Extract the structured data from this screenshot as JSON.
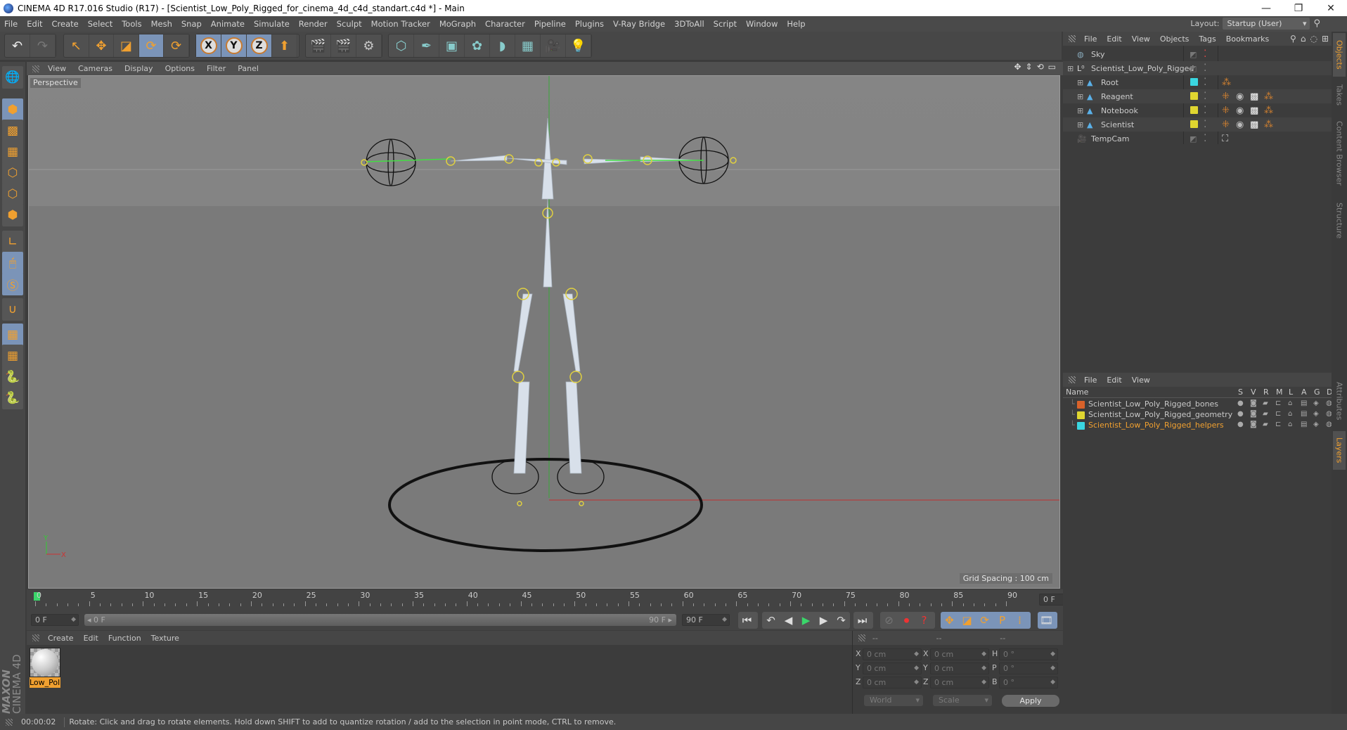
{
  "window": {
    "title": "CINEMA 4D R17.016 Studio (R17) - [Scientist_Low_Poly_Rigged_for_cinema_4d_c4d_standart.c4d *] - Main",
    "controls": {
      "minimize": "—",
      "restore": "❐",
      "close": "✕"
    }
  },
  "menubar": [
    "File",
    "Edit",
    "Create",
    "Select",
    "Tools",
    "Mesh",
    "Snap",
    "Animate",
    "Simulate",
    "Render",
    "Sculpt",
    "Motion Tracker",
    "MoGraph",
    "Character",
    "Pipeline",
    "Plugins",
    "V-Ray Bridge",
    "3DToAll",
    "Script",
    "Window",
    "Help"
  ],
  "layout": {
    "label": "Layout:",
    "value": "Startup (User)"
  },
  "toolbar": {
    "undo": "↶",
    "redo": "↷",
    "tools": [
      {
        "name": "live-selection",
        "glyph": "↖"
      },
      {
        "name": "move",
        "glyph": "✥"
      },
      {
        "name": "scale",
        "glyph": "◪"
      },
      {
        "name": "rotate",
        "glyph": "⟳"
      },
      {
        "name": "recent-tool",
        "glyph": "⟳"
      }
    ],
    "axes": [
      "X",
      "Y",
      "Z"
    ],
    "coord_system": "⬆",
    "render": [
      {
        "name": "render-view",
        "glyph": "🎬"
      },
      {
        "name": "render-picture-viewer",
        "glyph": "🎬"
      },
      {
        "name": "render-settings",
        "glyph": "⚙"
      }
    ],
    "create": [
      {
        "name": "cube",
        "glyph": "⬡"
      },
      {
        "name": "pen",
        "glyph": "✒"
      },
      {
        "name": "subdivision",
        "glyph": "▣"
      },
      {
        "name": "cloner",
        "glyph": "✿"
      },
      {
        "name": "deformer",
        "glyph": "◗"
      },
      {
        "name": "floor",
        "glyph": "▦"
      },
      {
        "name": "camera",
        "glyph": "🎥"
      },
      {
        "name": "light",
        "glyph": "💡"
      }
    ]
  },
  "left_tools": [
    {
      "name": "make-editable",
      "glyph": "🌐",
      "active": false
    },
    {
      "name": "model-mode",
      "glyph": "⬢",
      "active": true
    },
    {
      "name": "texture-mode",
      "glyph": "▩",
      "active": false
    },
    {
      "name": "workplane-mode",
      "glyph": "▦",
      "active": false
    },
    {
      "name": "points-mode",
      "glyph": "⬡",
      "active": false
    },
    {
      "name": "edges-mode",
      "glyph": "⬡",
      "active": false
    },
    {
      "name": "polygons-mode",
      "glyph": "⬢",
      "active": false
    },
    {
      "name": "axis-mode",
      "glyph": "∟",
      "active": false
    },
    {
      "name": "tweak-mode",
      "glyph": "🖱",
      "active": true
    },
    {
      "name": "solo-mode",
      "glyph": "Ⓢ",
      "active": true
    },
    {
      "name": "snap",
      "glyph": "∪",
      "active": false
    },
    {
      "name": "workplane-lock",
      "glyph": "▦",
      "active": true
    },
    {
      "name": "workplane-align",
      "glyph": "▦",
      "active": false
    },
    {
      "name": "python-1",
      "glyph": "🐍",
      "active": false
    },
    {
      "name": "python-2",
      "glyph": "🐍",
      "active": false
    }
  ],
  "viewport": {
    "menu": [
      "View",
      "Cameras",
      "Display",
      "Options",
      "Filter",
      "Panel"
    ],
    "camera_label": "Perspective",
    "grid_spacing": "Grid Spacing : 100 cm",
    "nav_icons": [
      "✥",
      "⇕",
      "⟲",
      "▭"
    ],
    "axis_labels": {
      "x": "X",
      "y": "Y",
      "z": "Z"
    }
  },
  "timeline": {
    "start": 0,
    "end": 90,
    "step": 5,
    "current_frame": 0,
    "current_field": "0 F",
    "range_start": "0 F",
    "range_slider_start": "0 F",
    "range_slider_end": "90 F",
    "range_end": "90 F"
  },
  "playback": {
    "buttons": [
      {
        "name": "go-to-start",
        "glyph": "⏮"
      },
      {
        "name": "prev-key",
        "glyph": "↶"
      },
      {
        "name": "prev-frame",
        "glyph": "◀"
      },
      {
        "name": "play",
        "glyph": "▶"
      },
      {
        "name": "next-frame",
        "glyph": "▶"
      },
      {
        "name": "next-key",
        "glyph": "↷"
      },
      {
        "name": "go-to-end",
        "glyph": "⏭"
      }
    ],
    "record": [
      {
        "name": "keyframe-selection",
        "glyph": "⊘"
      },
      {
        "name": "record-active",
        "glyph": "⏺"
      },
      {
        "name": "autokey",
        "glyph": "?"
      }
    ],
    "key_types": [
      {
        "name": "key-position",
        "glyph": "✥"
      },
      {
        "name": "key-scale",
        "glyph": "◪"
      },
      {
        "name": "key-rotation",
        "glyph": "⟳"
      },
      {
        "name": "key-param",
        "glyph": "P"
      },
      {
        "name": "key-pla",
        "glyph": "⁞"
      }
    ],
    "timeline_button": "🎞"
  },
  "materials": {
    "menu": [
      "Create",
      "Edit",
      "Function",
      "Texture"
    ],
    "items": [
      {
        "label": "Low_Pol"
      }
    ]
  },
  "coordinates": {
    "headers": [
      "--",
      "--",
      "--"
    ],
    "position": [
      {
        "axis": "X",
        "value": "0 cm"
      },
      {
        "axis": "Y",
        "value": "0 cm"
      },
      {
        "axis": "Z",
        "value": "0 cm"
      }
    ],
    "size": [
      {
        "axis": "X",
        "value": "0 cm"
      },
      {
        "axis": "Y",
        "value": "0 cm"
      },
      {
        "axis": "Z",
        "value": "0 cm"
      }
    ],
    "rotation": [
      {
        "axis": "H",
        "value": "0 °"
      },
      {
        "axis": "P",
        "value": "0 °"
      },
      {
        "axis": "B",
        "value": "0 °"
      }
    ],
    "mode": "World",
    "size_mode": "Scale",
    "apply": "Apply"
  },
  "status": {
    "time": "00:00:02",
    "message": "Rotate: Click and drag to rotate elements. Hold down SHIFT to add to quantize rotation / add to the selection in point mode, CTRL to remove."
  },
  "objects_panel": {
    "menu": [
      "File",
      "Edit",
      "View",
      "Objects",
      "Tags",
      "Bookmarks"
    ],
    "objects": [
      {
        "name": "Sky",
        "indent": 0,
        "icon": "sky",
        "color": null,
        "expand": false,
        "tags": []
      },
      {
        "name": "Scientist_Low_Poly_Rigged",
        "indent": 0,
        "icon": "null",
        "color": null,
        "expand": true,
        "tags": []
      },
      {
        "name": "Root",
        "indent": 1,
        "icon": "joint",
        "color": "#3ad6e0",
        "expand": true,
        "tags": [
          "ik"
        ]
      },
      {
        "name": "Reagent",
        "indent": 1,
        "icon": "joint",
        "color": "#e0d630",
        "expand": true,
        "tags": [
          "phong",
          "material",
          "texture",
          "ik"
        ]
      },
      {
        "name": "Notebook",
        "indent": 1,
        "icon": "joint",
        "color": "#e0d630",
        "expand": true,
        "tags": [
          "phong",
          "material",
          "texture",
          "ik"
        ]
      },
      {
        "name": "Scientist",
        "indent": 1,
        "icon": "joint",
        "color": "#e0d630",
        "expand": true,
        "tags": [
          "phong",
          "material",
          "texture",
          "ik"
        ]
      },
      {
        "name": "TempCam",
        "indent": 0,
        "icon": "camera",
        "color": null,
        "expand": false,
        "tags": [
          "target"
        ]
      }
    ]
  },
  "layers_panel": {
    "menu": [
      "File",
      "Edit",
      "View"
    ],
    "columns": [
      "Name",
      "S",
      "V",
      "R",
      "M",
      "L",
      "A",
      "G",
      "D"
    ],
    "layers": [
      {
        "name": "Scientist_Low_Poly_Rigged_bones",
        "color": "#d9622a",
        "selected": false
      },
      {
        "name": "Scientist_Low_Poly_Rigged_geometry",
        "color": "#e0d630",
        "selected": false
      },
      {
        "name": "Scientist_Low_Poly_Rigged_helpers",
        "color": "#3ad6e0",
        "selected": true
      }
    ]
  },
  "side_tabs": {
    "top": [
      {
        "label": "Objects",
        "active": true
      },
      {
        "label": "Takes",
        "active": false
      },
      {
        "label": "Content Browser",
        "active": false
      },
      {
        "label": "Structure",
        "active": false
      }
    ],
    "bottom": [
      {
        "label": "Attributes",
        "active": false
      },
      {
        "label": "Layers",
        "active": true
      }
    ]
  },
  "branding": {
    "maxon": "MAXON",
    "product": "CINEMA 4D"
  },
  "colors": {
    "accent": "#f0a030",
    "active_tool": "#7b94b8",
    "selected_layer_text": "#f0a030"
  }
}
